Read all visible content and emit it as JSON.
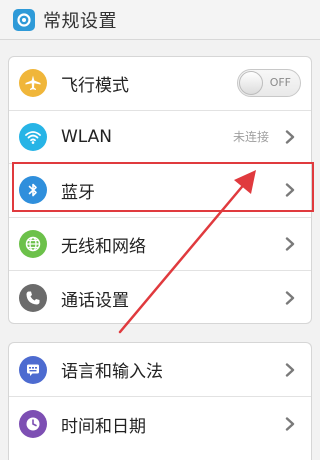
{
  "header": {
    "title": "常规设置",
    "icon": "settings-app-icon"
  },
  "section1": {
    "airplane": {
      "label": "飞行模式",
      "toggle": "OFF",
      "icon": "airplane-icon",
      "color": "#f0b63a"
    },
    "wlan": {
      "label": "WLAN",
      "status": "未连接",
      "icon": "wifi-icon",
      "color": "#27b4e6"
    },
    "bluetooth": {
      "label": "蓝牙",
      "icon": "bluetooth-icon",
      "color": "#2f8fdc"
    },
    "wireless": {
      "label": "无线和网络",
      "icon": "globe-icon",
      "color": "#6cc14a"
    },
    "call": {
      "label": "通话设置",
      "icon": "phone-icon",
      "color": "#6b6b6b"
    }
  },
  "section2": {
    "language": {
      "label": "语言和输入法",
      "icon": "keyboard-icon",
      "color": "#4d6bd0"
    },
    "datetime": {
      "label": "时间和日期",
      "icon": "clock-icon",
      "color": "#7d4fb3"
    }
  },
  "annotation": {
    "color": "#e03a3e"
  }
}
